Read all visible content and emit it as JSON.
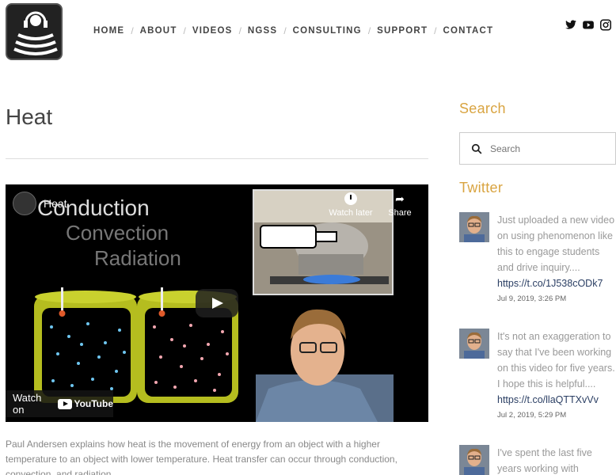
{
  "nav": {
    "items": [
      "HOME",
      "ABOUT",
      "VIDEOS",
      "NGSS",
      "CONSULTING",
      "SUPPORT",
      "CONTACT"
    ]
  },
  "social": [
    "twitter-icon",
    "youtube-icon",
    "instagram-icon"
  ],
  "main": {
    "title": "Heat",
    "video": {
      "title": "Heat",
      "slide_lines": [
        "Conduction",
        "Convection",
        "Radiation"
      ],
      "watch_later": "Watch later",
      "share": "Share",
      "watch_on": "Watch on",
      "youtube": "YouTube"
    },
    "description": "Paul Andersen explains how heat is the movement of energy from an object with a higher temperature to an object with lower temperature. Heat transfer can occur through conduction, convection, and radiation."
  },
  "sidebar": {
    "search_heading": "Search",
    "search_placeholder": "Search",
    "twitter_heading": "Twitter",
    "tweets": [
      {
        "text": "Just uploaded a new video on using phenomenon like this to engage students and drive inquiry....",
        "link": "https://t.co/1J538cODk7",
        "date": "Jul 9, 2019, 3:26 PM"
      },
      {
        "text": "It's not an exaggeration to say that I've been working on this video for five years. I hope this is helpful....",
        "link": "https://t.co/llaQTTXvVv",
        "date": "Jul 2, 2019, 5:29 PM"
      },
      {
        "text": "I've spent the last five years working with",
        "link": "",
        "date": ""
      }
    ]
  },
  "colors": {
    "accent": "#d9a441",
    "link": "#2a3e63"
  }
}
